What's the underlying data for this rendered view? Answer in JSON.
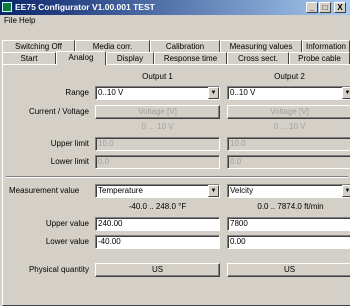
{
  "window": {
    "title": "EE75 Configurator V1.00.001 TEST",
    "minimize": "_",
    "maximize": "□",
    "close": "X"
  },
  "menu": [
    "File",
    "Help"
  ],
  "tabs_row1": [
    "Switching Off",
    "Media corr.",
    "Calibration",
    "Measuring values",
    "Information"
  ],
  "tabs_row2": [
    "Start",
    "Analog",
    "Display",
    "Response time",
    "Cross sect.",
    "Probe cable"
  ],
  "active_tab": "Analog",
  "headers": {
    "output1": "Output 1",
    "output2": "Output 2"
  },
  "labels": {
    "range": "Range",
    "current_voltage": "Current / Voltage",
    "upper_limit": "Upper limit",
    "lower_limit": "Lower limit",
    "measurement_value": "Measurement value",
    "upper_value": "Upper value",
    "lower_value": "Lower value",
    "physical_quantity": "Physical quantity"
  },
  "output1": {
    "range": "0..10 V",
    "voltage_button": "Voltage [V]",
    "range_hint": "0 ... 10 V",
    "upper_limit": "10.0",
    "lower_limit": "0.0",
    "measurement_value": "Temperature",
    "measurement_range": "-40.0 .. 248.0 °F",
    "upper_value": "240.00",
    "lower_value": "-40.00",
    "physical_quantity": "US"
  },
  "output2": {
    "range": "0..10 V",
    "voltage_button": "Voltage [V]",
    "range_hint": "0 ... 10 V",
    "upper_limit": "10.0",
    "lower_limit": "0.0",
    "measurement_value": "Velcity",
    "measurement_range": "0.0 .. 7874.0 ft/min",
    "upper_value": "7800",
    "lower_value": "0.00",
    "physical_quantity": "US"
  },
  "icons": {
    "dropdown": "chevron-down-icon",
    "app": "app-icon"
  },
  "colors": {
    "titlebar_start": "#0a246a",
    "titlebar_end": "#a6caf0",
    "face": "#d4d0c8"
  }
}
